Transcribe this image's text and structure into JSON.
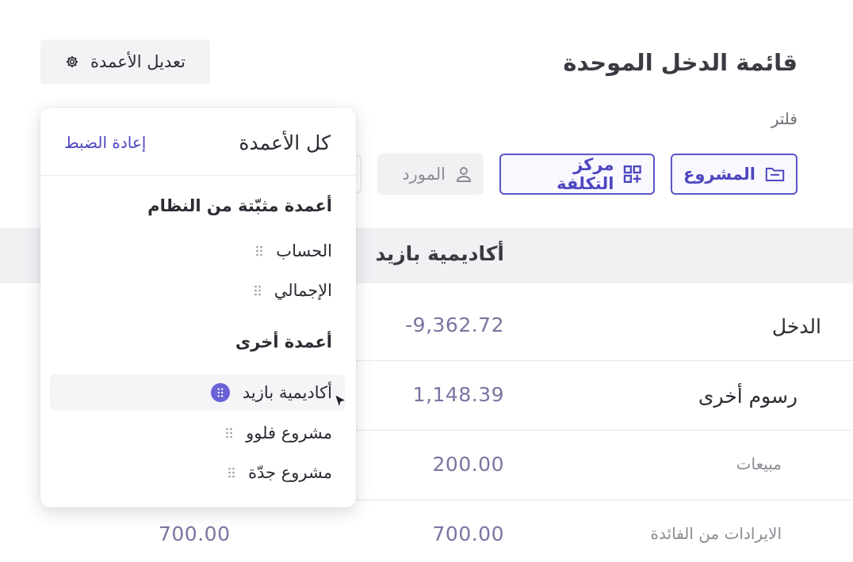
{
  "header": {
    "title": "قائمة الدخل الموحدة",
    "edit_columns_label": "تعديل الأعمدة",
    "filter_label": "فلتر"
  },
  "filters": {
    "project": {
      "label": "المشروع",
      "icon": "folder-icon"
    },
    "cost_center": {
      "label": "مركز التكلفة",
      "icon": "grid-plus-icon"
    },
    "supplier": {
      "label": "المورد",
      "icon": "user-icon"
    }
  },
  "table": {
    "column_header": "أكاديمية بازيد",
    "rows": [
      {
        "label": "الدخل",
        "value": "-9,362.72"
      },
      {
        "label": "رسوم أخرى",
        "value": "1,148.39"
      },
      {
        "label": "مبيعات",
        "value": "200.00"
      },
      {
        "label": "الايرادات من الفائدة",
        "value": "700.00",
        "value2": "700.00"
      }
    ]
  },
  "panel": {
    "title": "كل الأعمدة",
    "reset_label": "إعادة الضبط",
    "fixed_section": "أعمدة مثبّتة من النظام",
    "fixed_items": [
      "الحساب",
      "الإجمالي"
    ],
    "other_section": "أعمدة أخرى",
    "other_items": [
      "أكاديمية بازيد",
      "مشروع فلوو",
      "مشروع جدّة"
    ]
  },
  "colors": {
    "accent": "#4d46c0",
    "accent_fill": "#6a62d6",
    "header_band": "#f1f1f4",
    "value_text": "#7b74a0"
  }
}
